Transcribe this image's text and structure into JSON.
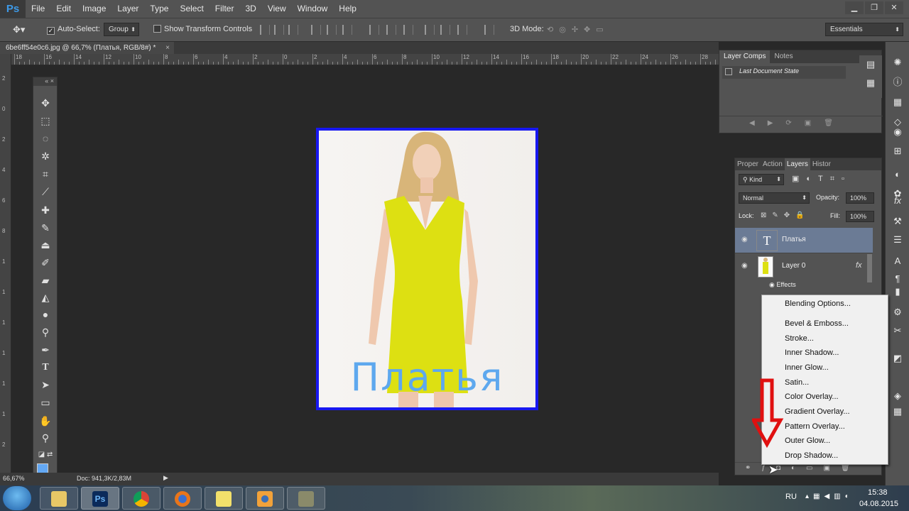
{
  "app": {
    "logo": "Ps"
  },
  "menu": [
    "File",
    "Edit",
    "Image",
    "Layer",
    "Type",
    "Select",
    "Filter",
    "3D",
    "View",
    "Window",
    "Help"
  ],
  "window_buttons": {
    "minimize": "▁",
    "maximize": "❐",
    "close": "✕"
  },
  "options": {
    "auto_select_label": "Auto-Select:",
    "auto_select_value": "Group",
    "show_transform_label": "Show Transform Controls",
    "mode_3d_label": "3D Mode:",
    "workspace": "Essentials"
  },
  "document": {
    "tab_title": "6be6ff54e0c6.jpg @ 66,7% (Платья, RGB/8#) *",
    "tab_close": "×",
    "canvas_text": "Платья",
    "zoom": "66,67%",
    "doc_info": "Doc: 941,3K/2,83M"
  },
  "rulers": {
    "h": [
      "18",
      "16",
      "14",
      "12",
      "10",
      "8",
      "6",
      "4",
      "2",
      "0",
      "2",
      "4",
      "6",
      "8",
      "10",
      "12",
      "14",
      "16",
      "18",
      "20",
      "22",
      "24",
      "26",
      "28"
    ],
    "v": [
      "2",
      "0",
      "2",
      "4",
      "6",
      "8",
      "1",
      "1",
      "1",
      "1",
      "1",
      "1",
      "2",
      "2"
    ]
  },
  "comp_panel": {
    "tabs": [
      "Layer Comps",
      "Notes"
    ],
    "state": "Last Document State"
  },
  "layers_panel": {
    "tabs": [
      "Proper",
      "Action",
      "Layers",
      "Histor"
    ],
    "kind": "Kind",
    "blend_mode": "Normal",
    "opacity_label": "Opacity:",
    "opacity_value": "100%",
    "lock_label": "Lock:",
    "fill_label": "Fill:",
    "fill_value": "100%",
    "layers": [
      {
        "name": "Платья",
        "thumb": "T"
      },
      {
        "name": "Layer 0",
        "fx": "fx"
      }
    ],
    "effects_label": "Effects"
  },
  "context_menu": [
    "Blending Options...",
    "Bevel & Emboss...",
    "Stroke...",
    "Inner Shadow...",
    "Inner Glow...",
    "Satin...",
    "Color Overlay...",
    "Gradient Overlay...",
    "Pattern Overlay...",
    "Outer Glow...",
    "Drop Shadow..."
  ],
  "taskbar": {
    "lang": "RU",
    "time": "15:38",
    "date": "04.08.2015"
  },
  "colors": {
    "foreground": "#63a8f4",
    "background": "#ffffff",
    "frame": "#1818f0",
    "arrow": "#e01010"
  }
}
